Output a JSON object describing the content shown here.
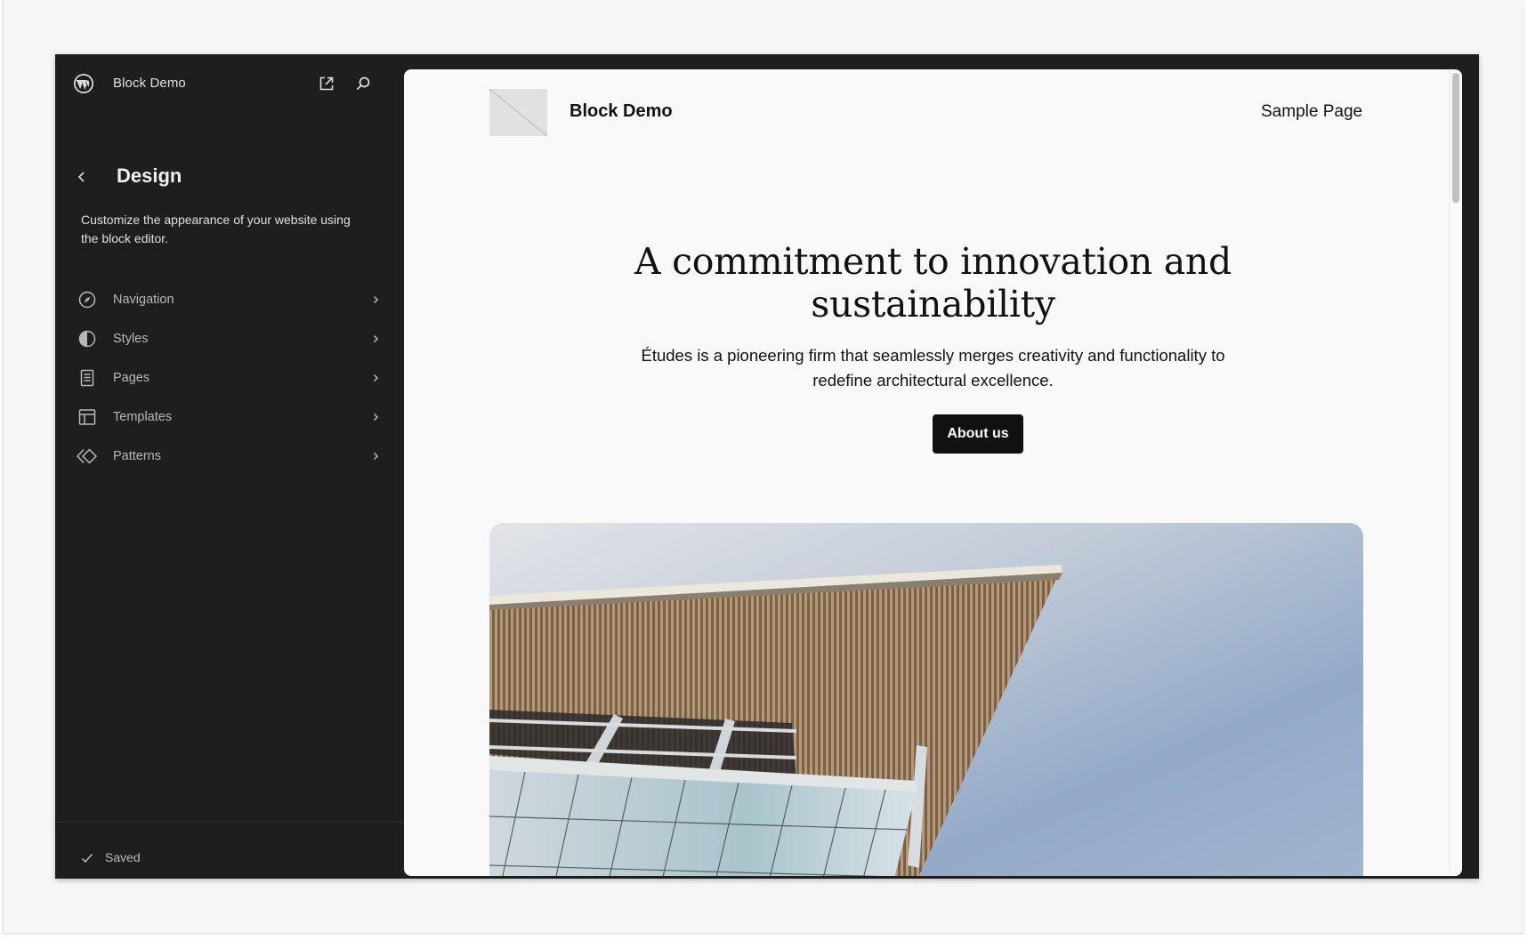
{
  "site_hub": {
    "site_title": "Block Demo",
    "view_site_icon": "external-link-icon",
    "search_icon": "search-icon",
    "logo_icon": "wordpress-logo-icon"
  },
  "screen": {
    "back_icon": "chevron-left-icon",
    "title": "Design",
    "description": "Customize the appearance of your website using the block editor."
  },
  "menu": {
    "items": [
      {
        "label": "Navigation",
        "icon": "navigation-compass-icon"
      },
      {
        "label": "Styles",
        "icon": "styles-half-circle-icon"
      },
      {
        "label": "Pages",
        "icon": "page-icon"
      },
      {
        "label": "Templates",
        "icon": "layout-icon"
      },
      {
        "label": "Patterns",
        "icon": "symbol-diamond-icon"
      }
    ]
  },
  "footer": {
    "status": "Saved",
    "status_icon": "check-icon"
  },
  "preview": {
    "site_name": "Block Demo",
    "nav_link": "Sample Page",
    "heading": "A commitment to innovation and sustainability",
    "paragraph": "Études is a pioneering firm that seamlessly merges creativity and functionality to redefine architectural excellence.",
    "button_label": "About us",
    "image_alt": "Building exterior viewed from below against a blue sky"
  },
  "colors": {
    "editor_bg": "#1e1e1e",
    "canvas_bg": "#f9f9f9",
    "button_bg": "#111111",
    "sidebar_text": "#e0e0e0",
    "menu_text": "#b8b8b8"
  }
}
